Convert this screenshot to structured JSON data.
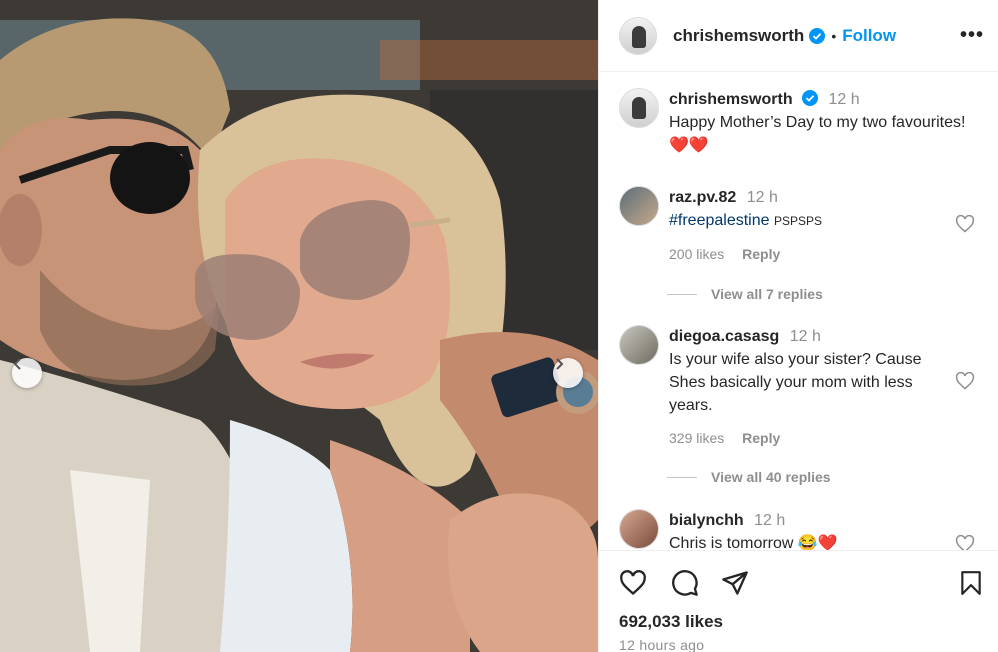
{
  "post": {
    "author": "chrishemsworth",
    "follow_label": "Follow",
    "separator": "•",
    "more": "•••",
    "caption": {
      "username": "chrishemsworth",
      "time": "12 h",
      "text": "Happy Mother’s Day to my two favourites!",
      "emoji": "❤️❤️"
    }
  },
  "comments": [
    {
      "username": "raz.pv.82",
      "time": "12 h",
      "hashtag": "#freepalestine",
      "text": "PSPSPS",
      "likes": "200 likes",
      "reply": "Reply",
      "view_replies": "View all 7 replies"
    },
    {
      "username": "diegoa.casasg",
      "time": "12 h",
      "text": "Is your wife also your sister? Cause Shes basically your mom with less years.",
      "likes": "329 likes",
      "reply": "Reply",
      "view_replies": "View all 40 replies"
    },
    {
      "username": "bialynchh",
      "time": "12 h",
      "text": "Chris is tomorrow",
      "emoji": "😂❤️"
    }
  ],
  "footer": {
    "likes": "692,033 likes",
    "posted": "12 hours ago"
  },
  "colors": {
    "accent": "#0095f6",
    "hashtag": "#00376b",
    "muted": "#8e8e8e"
  }
}
